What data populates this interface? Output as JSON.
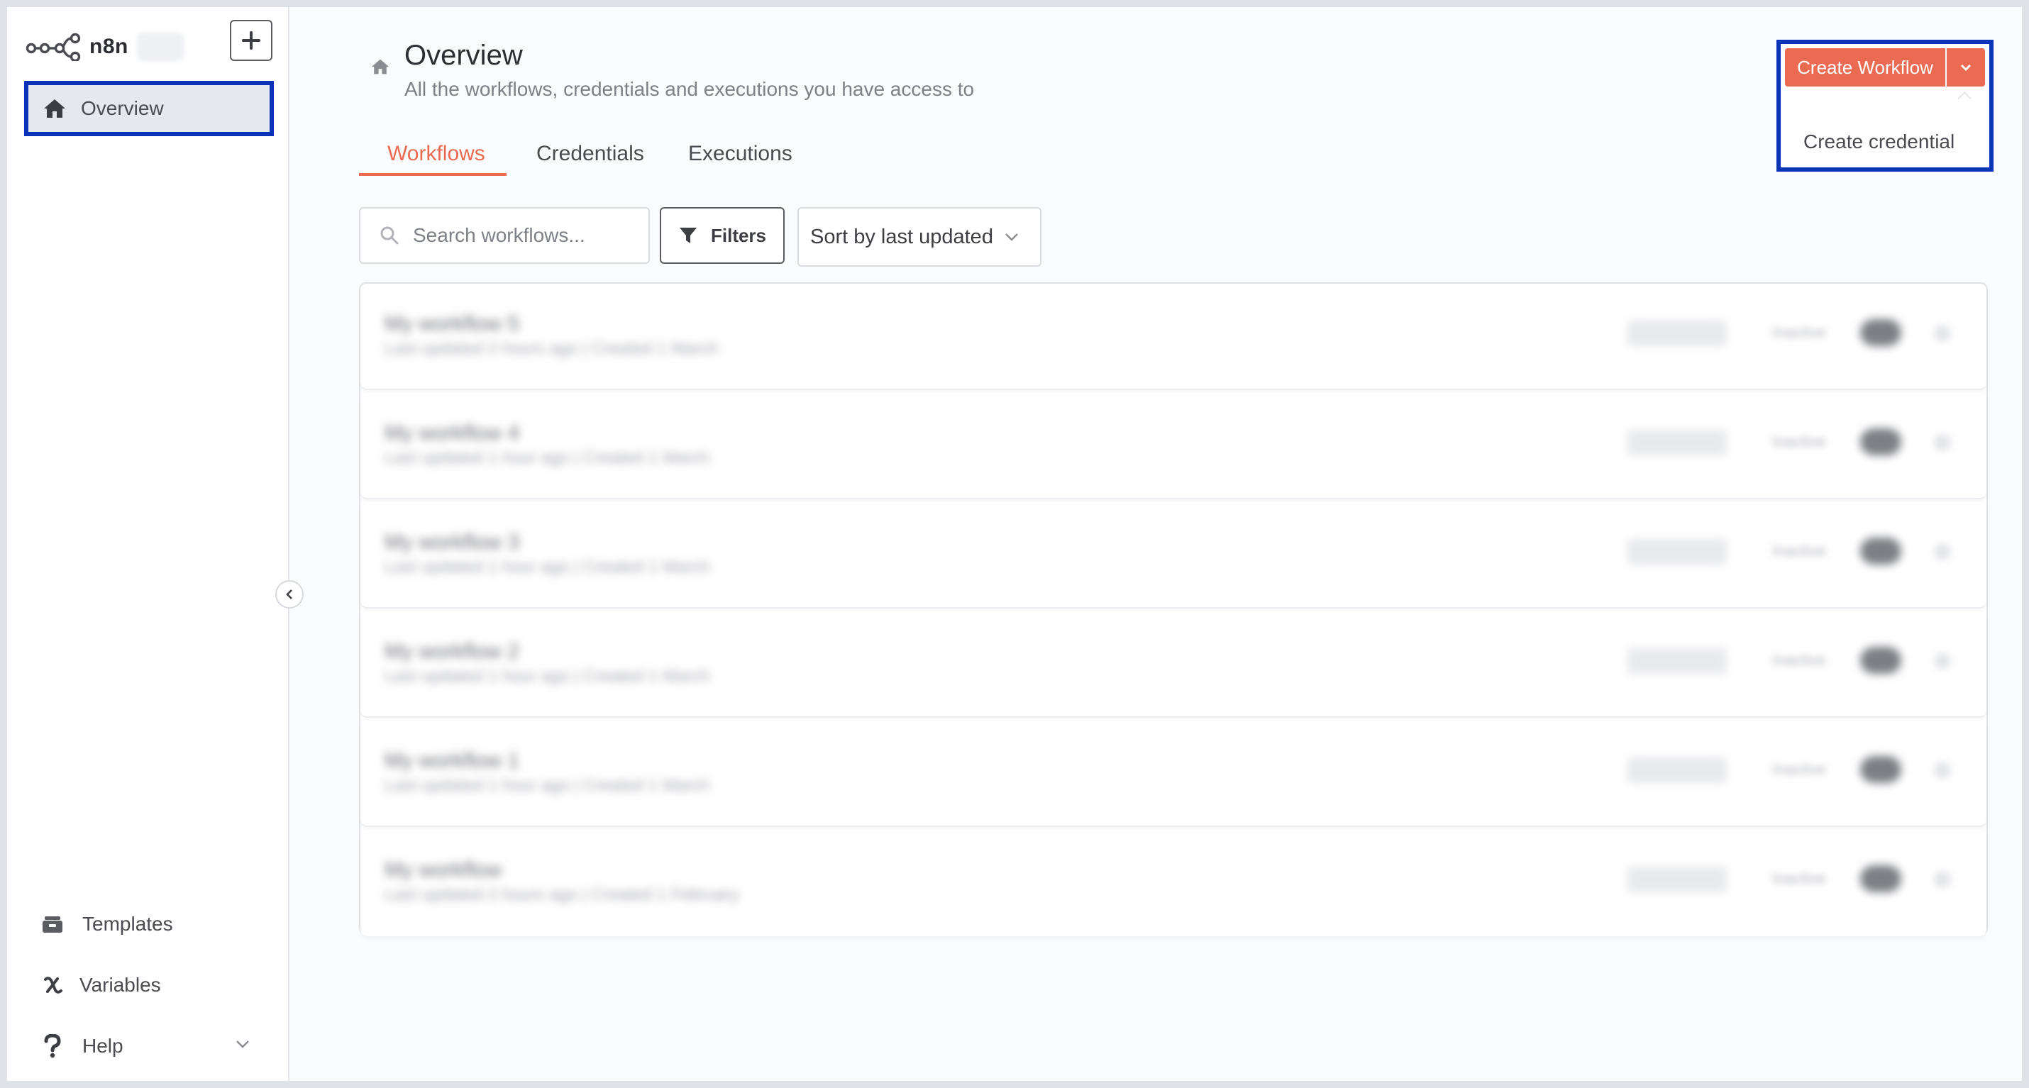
{
  "app": {
    "name": "n8n",
    "accent_color": "#ea6b52",
    "highlight_color": "#0a34b8"
  },
  "sidebar": {
    "logo_text": "n8n",
    "add_icon": "plus-icon",
    "active_item": {
      "label": "Overview",
      "icon": "home-icon"
    },
    "bottom_items": [
      {
        "label": "Templates",
        "icon": "templates-icon"
      },
      {
        "label": "Variables",
        "icon": "variables-icon"
      },
      {
        "label": "Help",
        "icon": "question-icon"
      }
    ]
  },
  "header": {
    "title": "Overview",
    "subtitle": "All the workflows, credentials and executions you have access to"
  },
  "tabs": [
    {
      "label": "Workflows",
      "active": true
    },
    {
      "label": "Credentials",
      "active": false
    },
    {
      "label": "Executions",
      "active": false
    }
  ],
  "toolbar": {
    "search_placeholder": "Search workflows...",
    "filters_label": "Filters",
    "sort_label": "Sort by last updated"
  },
  "create_menu": {
    "button_label": "Create Workflow",
    "items": [
      "Create credential"
    ]
  },
  "workflows": [
    {
      "name": "My workflow 5",
      "meta": "Last updated 2 hours ago | Created 1 March",
      "status": "Inactive"
    },
    {
      "name": "My workflow 4",
      "meta": "Last updated 1 hour ago | Created 1 March",
      "status": "Inactive"
    },
    {
      "name": "My workflow 3",
      "meta": "Last updated 1 hour ago | Created 1 March",
      "status": "Inactive"
    },
    {
      "name": "My workflow 2",
      "meta": "Last updated 1 hour ago | Created 1 March",
      "status": "Inactive"
    },
    {
      "name": "My workflow 1",
      "meta": "Last updated 1 hour ago | Created 1 March",
      "status": "Inactive"
    },
    {
      "name": "My workflow",
      "meta": "Last updated 2 hours ago | Created 1 February",
      "status": "Inactive"
    }
  ]
}
